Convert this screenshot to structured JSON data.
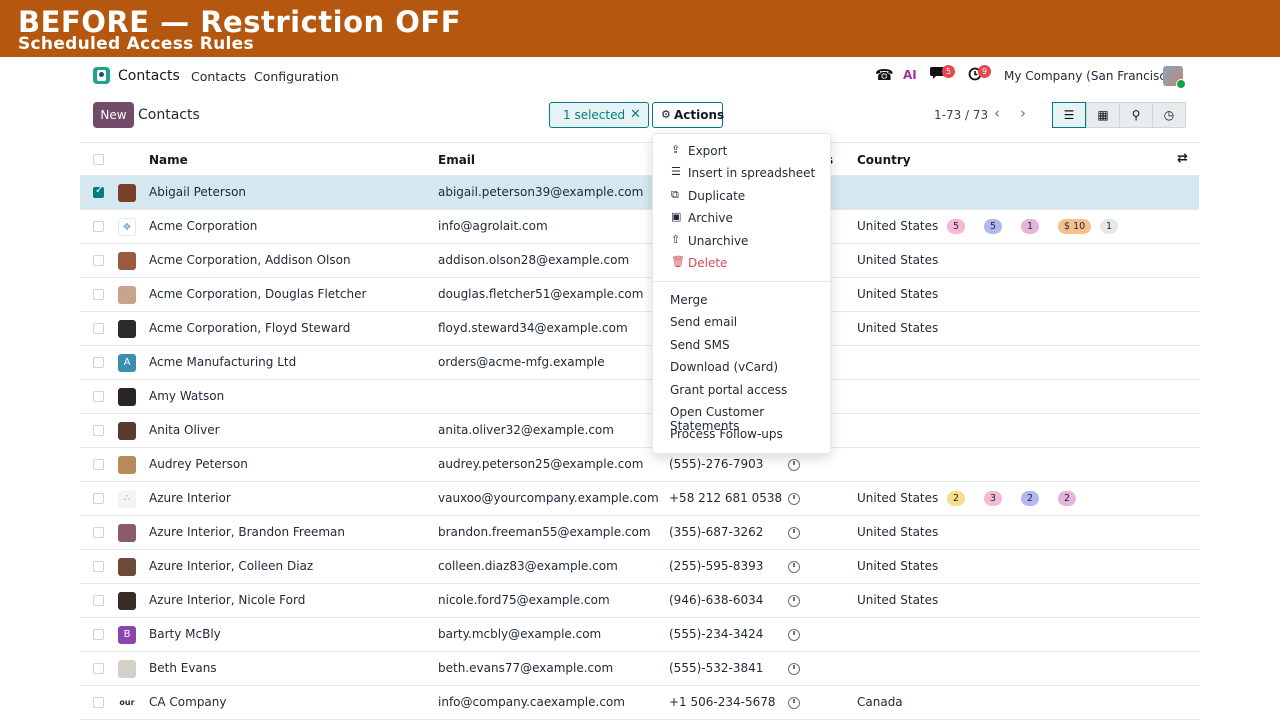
{
  "banner": {
    "title": "BEFORE — Restriction OFF",
    "subtitle": "Scheduled Access Rules"
  },
  "navbar": {
    "app_name": "Contacts",
    "menu": [
      "Contacts",
      "Configuration"
    ],
    "chat_count": "5",
    "activity_count": "9",
    "ai_label": "AI",
    "company": "My Company (San Francisco)"
  },
  "control": {
    "new_label": "New",
    "breadcrumb": "Contacts",
    "selected_label": "1 selected",
    "actions_label": "Actions",
    "pager": "1-73 / 73"
  },
  "columns": {
    "name": "Name",
    "email": "Email",
    "country": "Country",
    "hidden_fragment": "s"
  },
  "dropdown": {
    "group1": [
      {
        "label": "Export",
        "icon": "upload-icon"
      },
      {
        "label": "Insert in spreadsheet",
        "icon": "list-icon"
      },
      {
        "label": "Duplicate",
        "icon": "copy-icon"
      },
      {
        "label": "Archive",
        "icon": "archive-icon"
      },
      {
        "label": "Unarchive",
        "icon": "unarchive-icon"
      },
      {
        "label": "Delete",
        "icon": "trash-icon"
      }
    ],
    "group2": [
      "Merge",
      "Send email",
      "Send SMS",
      "Download (vCard)",
      "Grant portal access",
      "Open Customer Statements",
      "Process Follow-ups"
    ]
  },
  "rows": [
    {
      "name": "Abigail Peterson",
      "email": "abigail.peterson39@example.com",
      "phone": "",
      "country": "",
      "selected": true
    },
    {
      "name": "Acme Corporation",
      "email": "info@agrolait.com",
      "phone": "",
      "country": "United States"
    },
    {
      "name": "Acme Corporation, Addison Olson",
      "email": "addison.olson28@example.com",
      "phone": "",
      "country": "United States"
    },
    {
      "name": "Acme Corporation, Douglas Fletcher",
      "email": "douglas.fletcher51@example.com",
      "phone": "",
      "country": "United States"
    },
    {
      "name": "Acme Corporation, Floyd Steward",
      "email": "floyd.steward34@example.com",
      "phone": "",
      "country": "United States"
    },
    {
      "name": "Acme Manufacturing Ltd",
      "email": "orders@acme-mfg.example",
      "phone": "",
      "country": ""
    },
    {
      "name": "Amy Watson",
      "email": "",
      "phone": "",
      "country": ""
    },
    {
      "name": "Anita Oliver",
      "email": "anita.oliver32@example.com",
      "phone": "",
      "country": ""
    },
    {
      "name": "Audrey Peterson",
      "email": "audrey.peterson25@example.com",
      "phone": "(555)-276-7903",
      "country": ""
    },
    {
      "name": "Azure Interior",
      "email": "vauxoo@yourcompany.example.com",
      "phone": "+58 212 681 0538",
      "country": "United States"
    },
    {
      "name": "Azure Interior, Brandon Freeman",
      "email": "brandon.freeman55@example.com",
      "phone": "(355)-687-3262",
      "country": "United States"
    },
    {
      "name": "Azure Interior, Colleen Diaz",
      "email": "colleen.diaz83@example.com",
      "phone": "(255)-595-8393",
      "country": "United States"
    },
    {
      "name": "Azure Interior, Nicole Ford",
      "email": "nicole.ford75@example.com",
      "phone": "(946)-638-6034",
      "country": "United States"
    },
    {
      "name": "Barty McBly",
      "email": "barty.mcbly@example.com",
      "phone": "(555)-234-3424",
      "country": ""
    },
    {
      "name": "Beth Evans",
      "email": "beth.evans77@example.com",
      "phone": "(555)-532-3841",
      "country": ""
    },
    {
      "name": "CA Company",
      "email": "info@company.caexample.com",
      "phone": "+1 506-234-5678",
      "country": "Canada"
    }
  ],
  "avatar_letters": {
    "acme_mfg": "A",
    "barty": "B",
    "ca_logo": "our"
  },
  "tags_acme": [
    "5",
    "5",
    "1",
    "$ 10",
    "1"
  ],
  "tags_azure": [
    "2",
    "3",
    "2",
    "2"
  ],
  "colors": {
    "accent": "#017e84",
    "brand": "#714b67",
    "banner": "#b5570f",
    "danger": "#d44c59"
  }
}
